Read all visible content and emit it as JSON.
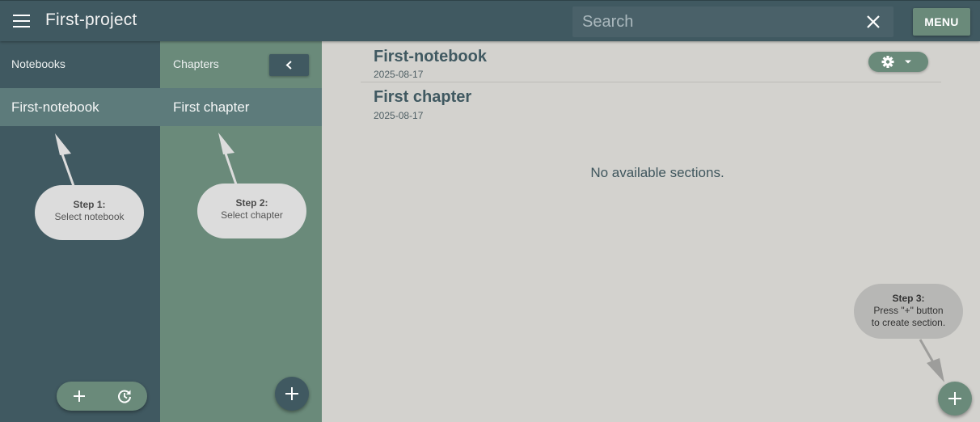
{
  "header": {
    "title": "First-project",
    "search_placeholder": "Search",
    "menu_label": "MENU"
  },
  "notebooks": {
    "heading": "Notebooks",
    "items": [
      {
        "label": "First-notebook",
        "selected": true
      }
    ]
  },
  "chapters": {
    "heading": "Chapters",
    "items": [
      {
        "label": "First chapter",
        "selected": true
      }
    ]
  },
  "main": {
    "notebook": {
      "title": "First-notebook",
      "date": "2025-08-17"
    },
    "chapter": {
      "title": "First chapter",
      "date": "2025-08-17"
    },
    "empty_message": "No available sections."
  },
  "tips": {
    "step1": {
      "title": "Step 1:",
      "text": "Select notebook"
    },
    "step2": {
      "title": "Step 2:",
      "text": "Select chapter"
    },
    "step3": {
      "title": "Step 3:",
      "line1": "Press \"+\" button",
      "line2": "to create section."
    }
  },
  "icons": {
    "menu": "hamburger-icon",
    "clear_search": "close-icon",
    "collapse": "chevron-left-icon",
    "add": "plus-icon",
    "history": "history-icon",
    "settings": "gear-icon",
    "dropdown": "caret-down-icon"
  },
  "colors": {
    "primary_dark": "#405961",
    "accent_green": "#6a8a7a",
    "selected_item": "#5d7b7b",
    "content_background": "#d3d2ce",
    "tip_bubble": "#dcdcdc"
  }
}
